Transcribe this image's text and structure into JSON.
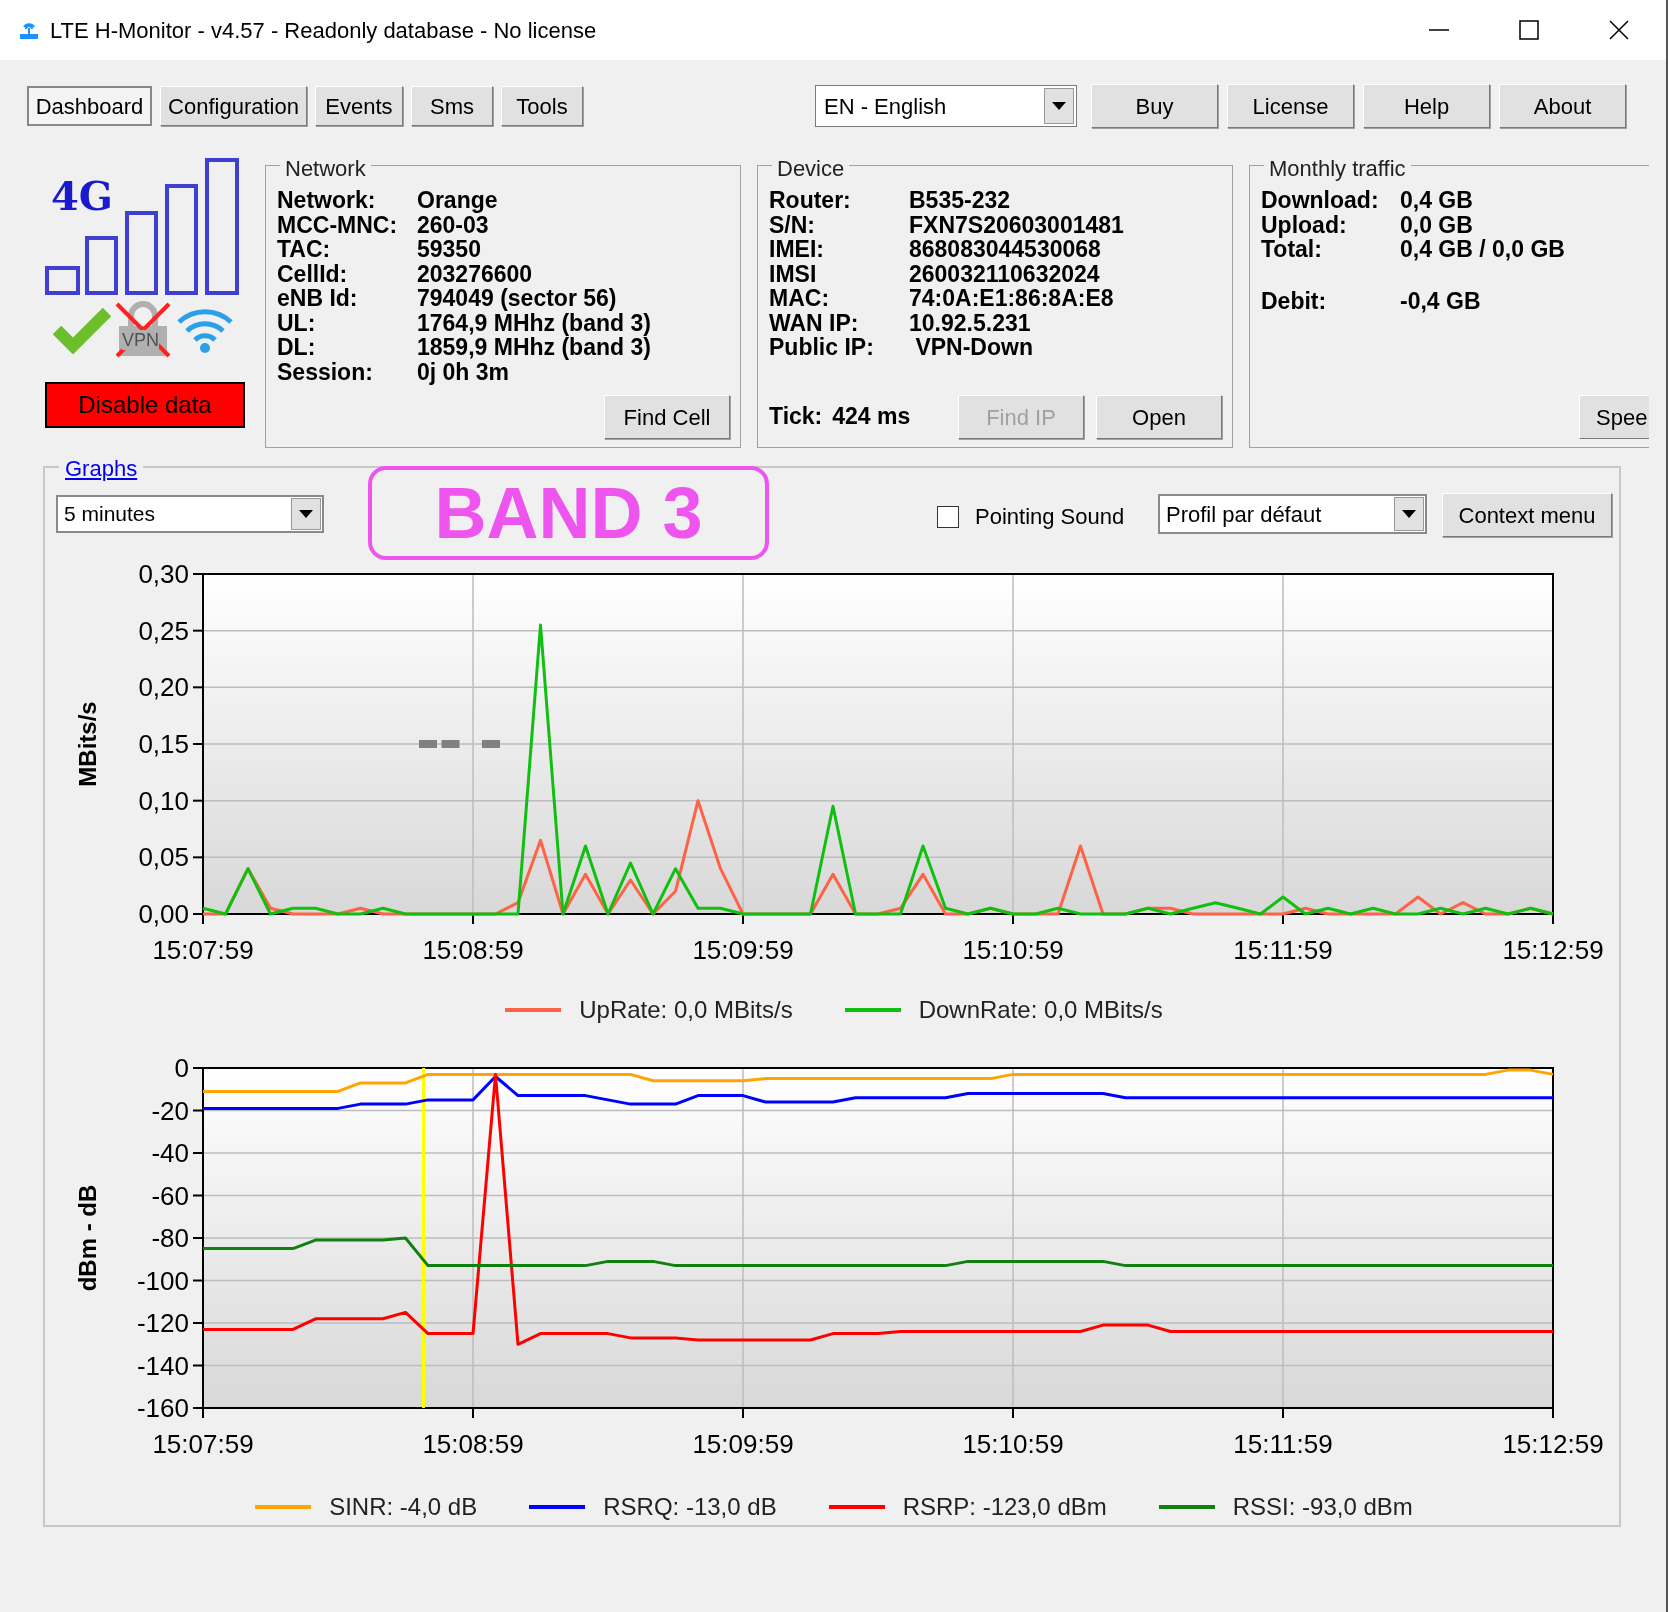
{
  "window": {
    "title": "LTE H-Monitor - v4.57 - Readonly database - No license"
  },
  "nav_tabs": [
    {
      "label": "Dashboard",
      "selected": true
    },
    {
      "label": "Configuration",
      "selected": false
    },
    {
      "label": "Events",
      "selected": false
    },
    {
      "label": "Sms",
      "selected": false
    },
    {
      "label": "Tools",
      "selected": false
    }
  ],
  "language_select": {
    "value": "EN - English"
  },
  "header_buttons": [
    "Buy",
    "License",
    "Help",
    "About"
  ],
  "status": {
    "network_type": "4G",
    "vpn_label": "VPN",
    "disable_button": "Disable data"
  },
  "network": {
    "title": "Network",
    "fields": [
      {
        "label": "Network:",
        "value": "Orange"
      },
      {
        "label": "MCC-MNC:",
        "value": "260-03"
      },
      {
        "label": "TAC:",
        "value": "59350"
      },
      {
        "label": "CellId:",
        "value": "203276600"
      },
      {
        "label": "eNB Id:",
        "value": "794049 (sector 56)"
      },
      {
        "label": "UL:",
        "value": "1764,9 MHhz (band 3)"
      },
      {
        "label": "DL:",
        "value": "1859,9 MHhz (band 3)"
      },
      {
        "label": "Session:",
        "value": "0j 0h 3m"
      }
    ],
    "button": "Find Cell"
  },
  "device": {
    "title": "Device",
    "fields": [
      {
        "label": "Router:",
        "value": "B535-232"
      },
      {
        "label": "S/N:",
        "value": "FXN7S20603001481"
      },
      {
        "label": "IMEI:",
        "value": "868083044530068"
      },
      {
        "label": "IMSI",
        "value": "260032110632024"
      },
      {
        "label": "MAC:",
        "value": "74:0A:E1:86:8A:E8"
      },
      {
        "label": "WAN IP:",
        "value": "10.92.5.231"
      },
      {
        "label": "Public IP:",
        "value": " VPN-Down"
      }
    ],
    "tick": {
      "label": "Tick:",
      "value": "424 ms"
    },
    "buttons": [
      {
        "label": "Find IP",
        "disabled": true
      },
      {
        "label": "Open",
        "disabled": false
      }
    ]
  },
  "monthly_traffic": {
    "title": "Monthly traffic",
    "fields": [
      {
        "label": "Download:",
        "value": "0,4 GB"
      },
      {
        "label": "Upload:",
        "value": "0,0 GB"
      },
      {
        "label": "Total:",
        "value": "0,4 GB / 0,0 GB"
      }
    ],
    "balance": [
      {
        "label": "Debit:",
        "value": "-0,4 GB"
      }
    ],
    "button": "Spee"
  },
  "graphs": {
    "title": "Graphs",
    "period": "5 minutes",
    "annotation": "BAND 3",
    "pointing_sound": {
      "label": "Pointing Sound",
      "checked": false
    },
    "profile": "Profil par défaut",
    "context_button": "Context menu",
    "throughput": {
      "chart_data": {
        "type": "line",
        "ylabel": "MBits/s",
        "ylim": [
          0,
          0.3
        ],
        "grid": true,
        "yticks": [
          {
            "value": 0,
            "label": "0,00"
          },
          {
            "value": 0.05,
            "label": "0,05"
          },
          {
            "value": 0.1,
            "label": "0,10"
          },
          {
            "value": 0.15,
            "label": "0,15"
          },
          {
            "value": 0.2,
            "label": "0,20"
          },
          {
            "value": 0.25,
            "label": "0,25"
          },
          {
            "value": 0.3,
            "label": "0,30"
          }
        ],
        "series": [
          {
            "name": "UpRate: 0,0 MBits/s",
            "color": "#ff6347",
            "values": [
              0,
              0,
              0.04,
              0.005,
              0,
              0,
              0,
              0.005,
              0,
              0,
              0,
              0,
              0,
              0,
              0.01,
              0.065,
              0,
              0.035,
              0,
              0.03,
              0,
              0.02,
              0.1,
              0.04,
              0,
              0,
              0,
              0,
              0.035,
              0,
              0,
              0.005,
              0.035,
              0,
              0,
              0.005,
              0,
              0,
              0,
              0.06,
              0,
              0,
              0.005,
              0.005,
              0,
              0,
              0,
              0,
              0,
              0.005,
              0,
              0,
              0,
              0,
              0.015,
              0,
              0.01,
              0,
              0,
              0.005,
              0
            ]
          },
          {
            "name": "DownRate: 0,0 MBits/s",
            "color": "#10c010",
            "values": [
              0.005,
              0,
              0.04,
              0,
              0.005,
              0.005,
              0,
              0,
              0.005,
              0,
              0,
              0,
              0,
              0,
              0,
              0.255,
              0,
              0.06,
              0,
              0.045,
              0,
              0.04,
              0.005,
              0.005,
              0,
              0,
              0,
              0,
              0.095,
              0,
              0,
              0,
              0.06,
              0.005,
              0,
              0.005,
              0,
              0,
              0.005,
              0,
              0,
              0,
              0.005,
              0,
              0.005,
              0.01,
              0.005,
              0,
              0.015,
              0,
              0.005,
              0,
              0.005,
              0,
              0,
              0.005,
              0,
              0.005,
              0,
              0.005,
              0
            ]
          }
        ],
        "categories": [
          "15:07:59",
          null,
          null,
          null,
          null,
          null,
          null,
          null,
          null,
          null,
          null,
          null,
          "15:08:59",
          null,
          null,
          null,
          null,
          null,
          null,
          null,
          null,
          null,
          null,
          null,
          "15:09:59",
          null,
          null,
          null,
          null,
          null,
          null,
          null,
          null,
          null,
          null,
          null,
          "15:10:59",
          null,
          null,
          null,
          null,
          null,
          null,
          null,
          null,
          null,
          null,
          null,
          "15:11:59",
          null,
          null,
          null,
          null,
          null,
          null,
          null,
          null,
          null,
          null,
          null,
          "15:12:59"
        ]
      }
    },
    "signal": {
      "chart_data": {
        "type": "line",
        "ylabel": "dBm - dB",
        "ylim": [
          -160,
          0
        ],
        "grid": true,
        "yticks": [
          0,
          -20,
          -40,
          -60,
          -80,
          -100,
          -120,
          -140,
          -160
        ],
        "series": [
          {
            "name": "SINR: -4,0 dB",
            "color": "#ffa500",
            "values": [
              -11,
              -11,
              -11,
              -11,
              -11,
              -11,
              -11,
              -7,
              -7,
              -7,
              -3,
              -3,
              -3,
              -3,
              -3,
              -3,
              -3,
              -3,
              -3,
              -3,
              -6,
              -6,
              -6,
              -6,
              -6,
              -5,
              -5,
              -5,
              -5,
              -5,
              -5,
              -5,
              -5,
              -5,
              -5,
              -5,
              -3,
              -3,
              -3,
              -3,
              -3,
              -3,
              -3,
              -3,
              -3,
              -3,
              -3,
              -3,
              -3,
              -3,
              -3,
              -3,
              -3,
              -3,
              -3,
              -3,
              -3,
              -3,
              -1,
              -1,
              -3
            ]
          },
          {
            "name": "RSRQ: -13,0 dB",
            "color": "#0000ff",
            "values": [
              -19,
              -19,
              -19,
              -19,
              -19,
              -19,
              -19,
              -17,
              -17,
              -17,
              -15,
              -15,
              -15,
              -4,
              -13,
              -13,
              -13,
              -13,
              -15,
              -17,
              -17,
              -17,
              -13,
              -13,
              -13,
              -16,
              -16,
              -16,
              -16,
              -14,
              -14,
              -14,
              -14,
              -14,
              -12,
              -12,
              -12,
              -12,
              -12,
              -12,
              -12,
              -14,
              -14,
              -14,
              -14,
              -14,
              -14,
              -14,
              -14,
              -14,
              -14,
              -14,
              -14,
              -14,
              -14,
              -14,
              -14,
              -14,
              -14,
              -14,
              -14
            ]
          },
          {
            "name": "RSRP: -123,0 dBm",
            "color": "#ff0000",
            "values": [
              -123,
              -123,
              -123,
              -123,
              -123,
              -118,
              -118,
              -118,
              -118,
              -115,
              -125,
              -125,
              -125,
              -3,
              -130,
              -125,
              -125,
              -125,
              -125,
              -127,
              -127,
              -127,
              -128,
              -128,
              -128,
              -128,
              -128,
              -128,
              -125,
              -125,
              -125,
              -124,
              -124,
              -124,
              -124,
              -124,
              -124,
              -124,
              -124,
              -124,
              -121,
              -121,
              -121,
              -124,
              -124,
              -124,
              -124,
              -124,
              -124,
              -124,
              -124,
              -124,
              -124,
              -124,
              -124,
              -124,
              -124,
              -124,
              -124,
              -124,
              -124
            ]
          },
          {
            "name": "RSSI: -93,0 dBm",
            "color": "#108010",
            "values": [
              -85,
              -85,
              -85,
              -85,
              -85,
              -81,
              -81,
              -81,
              -81,
              -80,
              -93,
              -93,
              -93,
              -93,
              -93,
              -93,
              -93,
              -93,
              -91,
              -91,
              -91,
              -93,
              -93,
              -93,
              -93,
              -93,
              -93,
              -93,
              -93,
              -93,
              -93,
              -93,
              -93,
              -93,
              -91,
              -91,
              -91,
              -91,
              -91,
              -91,
              -91,
              -93,
              -93,
              -93,
              -93,
              -93,
              -93,
              -93,
              -93,
              -93,
              -93,
              -93,
              -93,
              -93,
              -93,
              -93,
              -93,
              -93,
              -93,
              -93,
              -93
            ]
          }
        ],
        "categories": [
          "15:07:59",
          null,
          null,
          null,
          null,
          null,
          null,
          null,
          null,
          null,
          null,
          null,
          "15:08:59",
          null,
          null,
          null,
          null,
          null,
          null,
          null,
          null,
          null,
          null,
          null,
          "15:09:59",
          null,
          null,
          null,
          null,
          null,
          null,
          null,
          null,
          null,
          null,
          null,
          "15:10:59",
          null,
          null,
          null,
          null,
          null,
          null,
          null,
          null,
          null,
          null,
          null,
          "15:11:59",
          null,
          null,
          null,
          null,
          null,
          null,
          null,
          null,
          null,
          null,
          null,
          "15:12:59"
        ]
      }
    }
  }
}
